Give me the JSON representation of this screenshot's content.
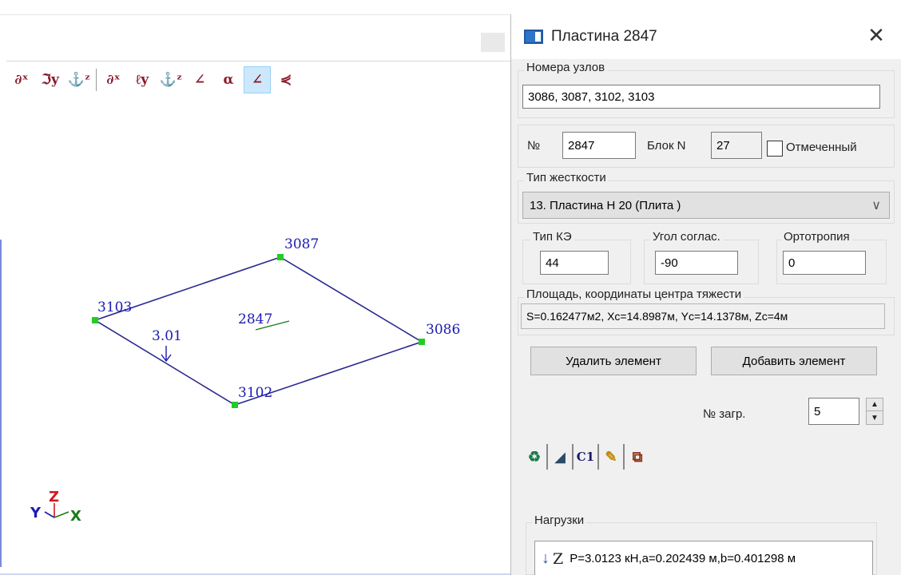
{
  "toolbar": {
    "buttons": [
      {
        "name": "rotate-x-icon",
        "glyph": "∂ˣ"
      },
      {
        "name": "rotate-y-icon",
        "glyph": "ℑy"
      },
      {
        "name": "rotate-z-icon",
        "glyph": "⚓ᶻ"
      },
      {
        "name": "rotate-x2-icon",
        "glyph": "∂ˣ"
      },
      {
        "name": "rotate-y2-icon",
        "glyph": "ℓy"
      },
      {
        "name": "rotate-z2-icon",
        "glyph": "⚓ᶻ"
      },
      {
        "name": "local-axes-icon",
        "glyph": "∠"
      },
      {
        "name": "alpha-icon",
        "glyph": "α"
      },
      {
        "name": "axes-active-icon",
        "glyph": "∠"
      },
      {
        "name": "axes-arrows-icon",
        "glyph": "⋞"
      }
    ]
  },
  "model": {
    "nodes": [
      {
        "id": "3087",
        "label": "3087"
      },
      {
        "id": "3103",
        "label": "3103"
      },
      {
        "id": "3086",
        "label": "3086"
      },
      {
        "id": "3102",
        "label": "3102"
      }
    ],
    "element_label": "2847",
    "load_label": "3.01",
    "axis_labels": {
      "y": "Y",
      "z": "Z",
      "x": "X"
    },
    "colors": {
      "edge": "#28288f",
      "node": "#22cc22",
      "axis_x": "#1a7a1a",
      "axis_y": "#1a1ab0",
      "axis_z": "#d11a1a"
    }
  },
  "dialog": {
    "title": "Пластина  2847",
    "close_glyph": "✕",
    "nodes_group": {
      "label": "Номера узлов",
      "value": "3086, 3087, 3102, 3103"
    },
    "id_row": {
      "number_label": "№",
      "number_value": "2847",
      "block_label": "Блок N",
      "block_value": "27",
      "marked_label": "Отмеченный",
      "marked_checked": false
    },
    "stiffness_group": {
      "label": "Тип жесткости",
      "selected": "13. Пластина  H 20 (Плита )",
      "chevron": "∨"
    },
    "fe_type": {
      "label": "Тип КЭ",
      "value": "44"
    },
    "angle": {
      "label": "Угол соглас.",
      "value": "-90"
    },
    "ortho": {
      "label": "Ортотропия",
      "value": "0"
    },
    "area_group": {
      "label": "Площадь, координаты центра тяжести",
      "value": "S=0.162477м2, Xc=14.8987м, Yc=14.1378м, Zc=4м"
    },
    "delete_button": "Удалить элемент",
    "add_button": "Добавить элемент",
    "load_case": {
      "label": "№ загр.",
      "value": "5",
      "up": "▲",
      "down": "▼"
    },
    "tabs": [
      {
        "name": "tab-properties-icon",
        "glyph": "♻"
      },
      {
        "name": "tab-shape-icon",
        "glyph": "◢"
      },
      {
        "name": "tab-c1-icon",
        "glyph": "C1"
      },
      {
        "name": "tab-edit-icon",
        "glyph": "✎"
      },
      {
        "name": "tab-copy-icon",
        "glyph": "⧉"
      }
    ],
    "loads_group": {
      "label": "Нагрузки",
      "items": [
        {
          "arrow": "↓",
          "axis": "Z",
          "text": "P=3.0123 кН,a=0.202439 м,b=0.401298 м"
        }
      ]
    }
  }
}
